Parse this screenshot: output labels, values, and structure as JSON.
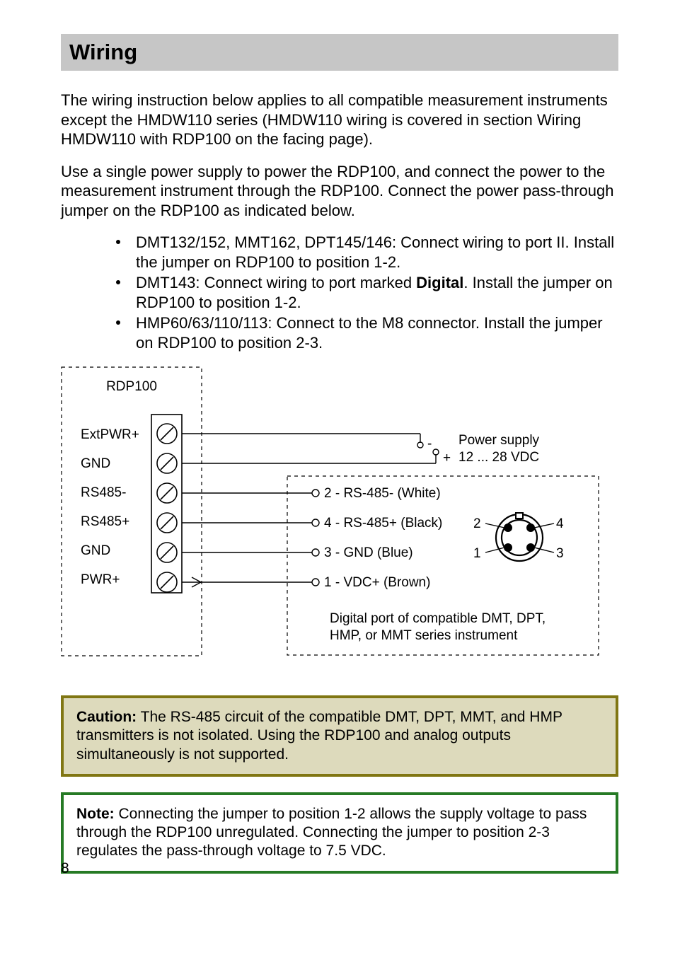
{
  "header": {
    "title": "Wiring"
  },
  "paragraphs": {
    "p1": "The wiring instruction below applies to all compatible measurement instruments except the HMDW110 series (HMDW110 wiring is covered in section Wiring HMDW110 with RDP100 on the facing page).",
    "p2": "Use a single power supply to power the RDP100, and connect the power to the measurement instrument through the RDP100. Connect the power pass-through jumper on the RDP100 as indicated below."
  },
  "bullets": [
    {
      "text": "DMT132/152, MMT162, DPT145/146: Connect wiring to port II. Install the jumper on RDP100 to position 1-2."
    },
    {
      "pre": "DMT143: Connect wiring to port marked ",
      "bold": "Digital",
      "post": ". Install the jumper on RDP100 to position 1-2."
    },
    {
      "text": "HMP60/63/110/113: Connect to the M8 connector. Install the jumper on RDP100 to position 2-3."
    }
  ],
  "diagram": {
    "device": "RDP100",
    "terminals": [
      "ExtPWR+",
      "GND",
      "RS485-",
      "RS485+",
      "GND",
      "PWR+"
    ],
    "power": {
      "minus": "-",
      "plus": "+",
      "label_line1": "Power supply",
      "label_line2": "12 ... 28 VDC"
    },
    "wires": {
      "w2": "2 - RS-485- (White)",
      "w4": "4 - RS-485+ (Black)",
      "w3": "3 - GND (Blue)",
      "w1": "1 - VDC+ (Brown)"
    },
    "connector": {
      "n1": "1",
      "n2": "2",
      "n3": "3",
      "n4": "4"
    },
    "footer_line1": "Digital port of compatible DMT, DPT,",
    "footer_line2": "HMP, or MMT series instrument"
  },
  "callouts": {
    "caution_label": "Caution:",
    "caution_text": " The RS-485 circuit of the compatible DMT, DPT, MMT, and HMP transmitters is not isolated. Using the RDP100 and analog outputs simultaneously is not supported.",
    "note_label": "Note:",
    "note_text": " Connecting the jumper to position 1-2 allows the supply voltage to pass through the RDP100 unregulated. Connecting the jumper to position 2-3 regulates the pass-through voltage to 7.5 VDC."
  },
  "page_number": "8"
}
